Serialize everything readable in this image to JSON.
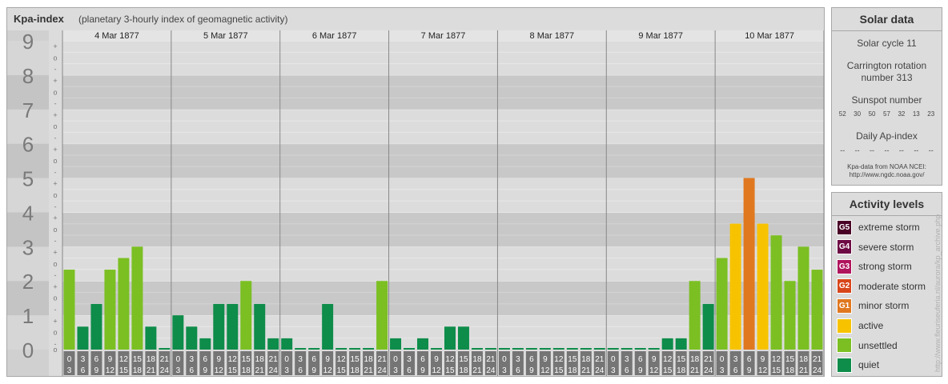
{
  "title": "Kpa-index",
  "subtitle": "(planetary 3-hourly index of geomagnetic activity)",
  "chart_data": {
    "type": "bar",
    "ylim": [
      0,
      9
    ],
    "y_ticks": [
      "0",
      "1",
      "2",
      "3",
      "4",
      "5",
      "6",
      "7",
      "8",
      "9"
    ],
    "y_minor_marks": [
      "+",
      "o",
      "-"
    ],
    "days": [
      "4 Mar 1877",
      "5 Mar 1877",
      "6 Mar 1877",
      "7 Mar 1877",
      "8 Mar 1877",
      "9 Mar 1877",
      "10 Mar 1877"
    ],
    "interval_start_labels": [
      "0",
      "3",
      "6",
      "9",
      "12",
      "15",
      "18",
      "21"
    ],
    "interval_end_labels": [
      "3",
      "6",
      "9",
      "12",
      "15",
      "18",
      "21",
      "24"
    ],
    "values": [
      [
        2.33,
        0.67,
        1.33,
        2.33,
        2.67,
        3.0,
        0.67,
        0.0
      ],
      [
        1.0,
        0.67,
        0.33,
        1.33,
        1.33,
        2.0,
        1.33,
        0.33
      ],
      [
        0.33,
        0.0,
        0.0,
        1.33,
        0.0,
        0.0,
        0.0,
        2.0
      ],
      [
        0.33,
        0.0,
        0.33,
        0.0,
        0.67,
        0.67,
        0.0,
        0.0
      ],
      [
        0.0,
        0.0,
        0.0,
        0.0,
        0.0,
        0.0,
        0.0,
        0.0
      ],
      [
        0.0,
        0.0,
        0.0,
        0.0,
        0.33,
        0.33,
        2.0,
        1.33
      ],
      [
        2.67,
        3.67,
        5.0,
        3.67,
        3.33,
        2.0,
        3.0,
        2.33
      ]
    ],
    "colors": {
      "quiet": "#0e8c4a",
      "unsettled": "#7bbf23",
      "active": "#f7c300",
      "minor": "#e07820",
      "moderate": "#d8461c",
      "strong": "#b0145c",
      "severe": "#6e0a44",
      "extreme": "#4a0026"
    }
  },
  "solar": {
    "title": "Solar data",
    "cycle": "Solar cycle 11",
    "carrington_line1": "Carrington rotation",
    "carrington_line2": "number 313",
    "sunspot_title": "Sunspot number",
    "sunspots": [
      "52",
      "30",
      "50",
      "57",
      "32",
      "13",
      "23"
    ],
    "ap_title": "Daily Ap-index",
    "ap_values": [
      "--",
      "--",
      "--",
      "--",
      "--",
      "--",
      "--"
    ],
    "credit_line1": "Kpa-data from NOAA NCEI:",
    "credit_line2": "http://www.ngdc.noaa.gov/"
  },
  "activity": {
    "title": "Activity levels",
    "items": [
      {
        "code": "G5",
        "label": "extreme storm",
        "color": "#4a0026"
      },
      {
        "code": "G4",
        "label": "severe storm",
        "color": "#6e0a44"
      },
      {
        "code": "G3",
        "label": "strong storm",
        "color": "#b0145c"
      },
      {
        "code": "G2",
        "label": "moderate storm",
        "color": "#d8461c"
      },
      {
        "code": "G1",
        "label": "minor storm",
        "color": "#e07820"
      },
      {
        "code": "",
        "label": "active",
        "color": "#f7c300"
      },
      {
        "code": "",
        "label": "unsettled",
        "color": "#7bbf23"
      },
      {
        "code": "",
        "label": "quiet",
        "color": "#0e8c4a"
      }
    ]
  },
  "watermark": "http://www.fleuriseuferia.nl/aurora/kp_archive.php"
}
